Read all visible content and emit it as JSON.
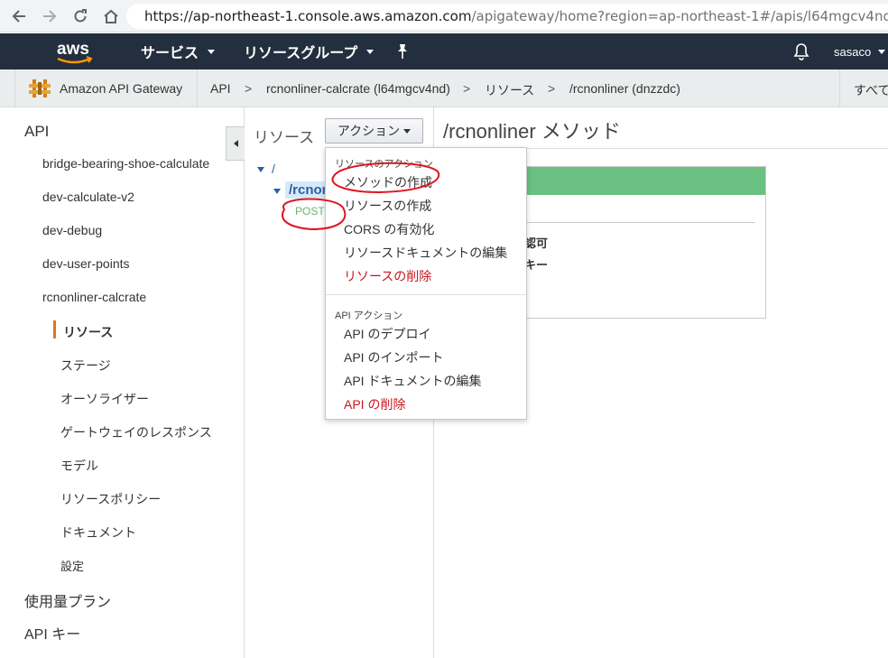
{
  "browser": {
    "url_host": "https://ap-northeast-1.console.aws.amazon.com",
    "url_path": "/apigateway/home?region=ap-northeast-1#/apis/l64mgcv4nd/resou"
  },
  "top_nav": {
    "logo_text": "aws",
    "services_label": "サービス",
    "resource_groups_label": "リソースグループ",
    "user_label": "sasaco"
  },
  "breadcrumb": {
    "service_name": "Amazon API Gateway",
    "items": [
      "API",
      "rcnonliner-calcrate (l64mgcv4nd)",
      "リソース",
      "/rcnonliner (dnzzdc)"
    ],
    "separator": ">",
    "right_text": "すべて"
  },
  "sidebar": {
    "api_header": "API",
    "apis": [
      "bridge-bearing-shoe-calculate",
      "dev-calculate-v2",
      "dev-debug",
      "dev-user-points",
      "rcnonliner-calcrate"
    ],
    "sub_items": [
      "リソース",
      "ステージ",
      "オーソライザー",
      "ゲートウェイのレスポンス",
      "モデル",
      "リソースポリシー",
      "ドキュメント",
      "設定"
    ],
    "bottom_items": [
      "使用量プラン",
      "API キー"
    ]
  },
  "tree": {
    "title": "リソース",
    "action_button": "アクション",
    "root": "/",
    "resource": "/rcnonl",
    "method": "POST"
  },
  "main": {
    "title": "/rcnonliner メソッド",
    "card_line1": "認可",
    "card_line2": "キー"
  },
  "dropdown": {
    "resource_header": "リソースのアクション",
    "resource_items": [
      {
        "label": "メソッドの作成",
        "danger": false
      },
      {
        "label": "リソースの作成",
        "danger": false
      },
      {
        "label": "CORS の有効化",
        "danger": false
      },
      {
        "label": "リソースドキュメントの編集",
        "danger": false
      },
      {
        "label": "リソースの削除",
        "danger": true
      }
    ],
    "api_header": "API アクション",
    "api_items": [
      {
        "label": "API のデプロイ",
        "danger": false
      },
      {
        "label": "API のインポート",
        "danger": false
      },
      {
        "label": "API ドキュメントの編集",
        "danger": false
      },
      {
        "label": "API の削除",
        "danger": true
      }
    ]
  },
  "colors": {
    "aws_nav": "#232f3e",
    "accent_orange": "#ec7211",
    "link_blue": "#2b5fa3",
    "success_green": "#6ac080",
    "danger_red": "#c7161c",
    "annotation_red": "#e0141e"
  }
}
